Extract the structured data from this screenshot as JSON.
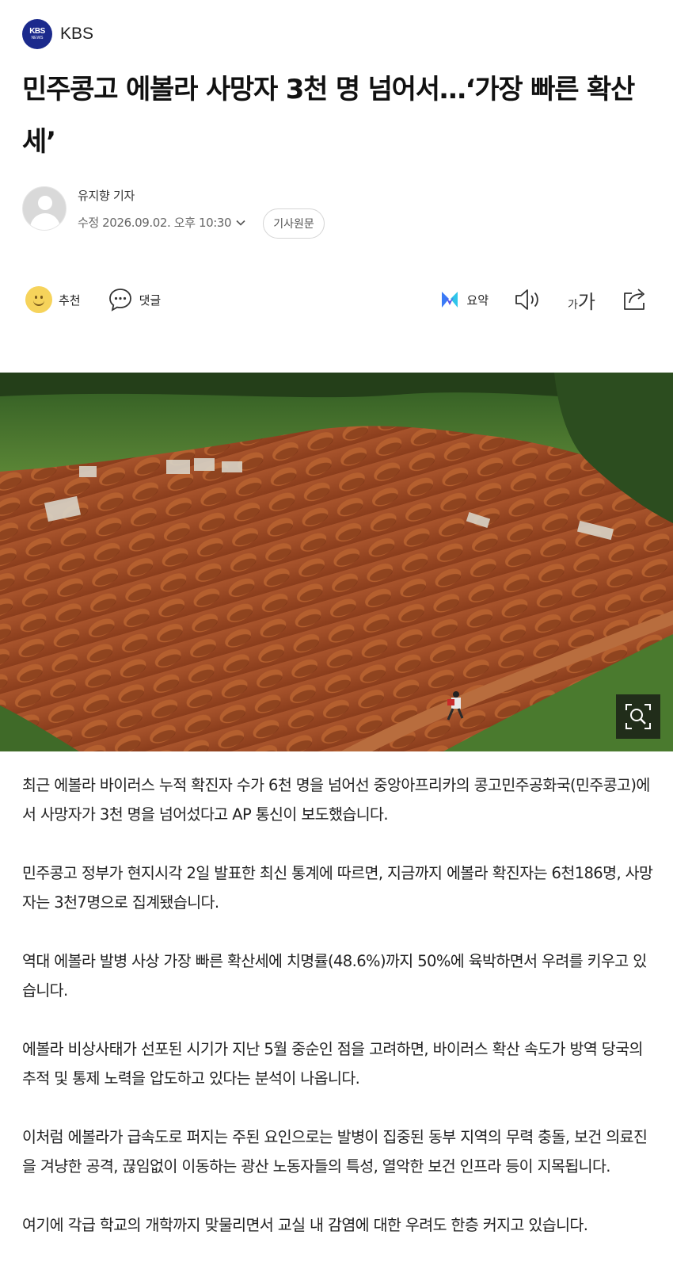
{
  "header": {
    "logo_line1": "KBS",
    "logo_line2": "NEWS",
    "press_name": "KBS"
  },
  "article": {
    "title": "민주콩고 에볼라 사망자 3천 명 넘어서…‘가장 빠른 확산세’",
    "reporter": "유지향 기자",
    "dateline": "수정 2026.09.02. 오후 10:30",
    "original_button": "기사원문"
  },
  "toolbar": {
    "recommend_label": "추천",
    "comment_label": "댓글",
    "summary_label": "요약",
    "font_small": "가",
    "font_big": "가"
  },
  "photo": {
    "description_icon": "zoom-search-icon"
  },
  "body": {
    "paragraphs": [
      "최근 에볼라 바이러스 누적 확진자 수가 6천 명을 넘어선 중앙아프리카의 콩고민주공화국(민주콩고)에서 사망자가 3천 명을 넘어섰다고 AP 통신이 보도했습니다.",
      "민주콩고 정부가 현지시각 2일 발표한 최신 통계에 따르면, 지금까지 에볼라 확진자는 6천186명, 사망자는 3천7명으로 집계됐습니다.",
      "역대 에볼라 발병 사상 가장 빠른 확산세에 치명률(48.6%)까지 50%에 육박하면서 우려를 키우고 있습니다.",
      "에볼라 비상사태가 선포된 시기가 지난 5월 중순인 점을 고려하면, 바이러스 확산 속도가 방역 당국의 추적 및 통제 노력을 압도하고 있다는 분석이 나옵니다.",
      "이처럼 에볼라가 급속도로 퍼지는 주된 요인으로는 발병이 집중된 동부 지역의 무력 충돌, 보건 의료진을 겨냥한 공격, 끊임없이 이동하는 광산 노동자들의 특성, 열악한 보건 인프라 등이 지목됩니다.",
      "여기에 각급 학교의 개학까지 맞물리면서 교실 내 감염에 대한 우려도 한층 커지고 있습니다."
    ]
  },
  "colors": {
    "logo_bg": "#1b2a8c",
    "smiley": "#f6d35b",
    "summary_blue": "#3a7bf6",
    "soil": "#9a4a26",
    "grass": "#4f7a2f"
  }
}
